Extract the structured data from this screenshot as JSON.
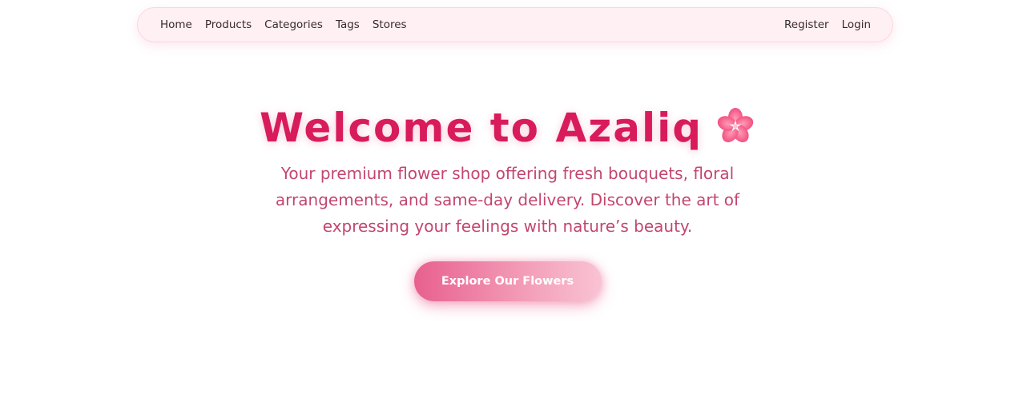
{
  "nav": {
    "left_links": [
      "Home",
      "Products",
      "Categories",
      "Tags",
      "Stores"
    ],
    "right_links": [
      "Register",
      "Login"
    ]
  },
  "hero": {
    "title": "Welcome to Azaliq",
    "icon": "cherry-blossom-icon",
    "subtitle": "Your premium flower shop offering fresh bouquets, floral arrangements, and same-day delivery. Discover the art of expressing your feelings with nature’s beauty.",
    "cta_label": "Explore Our Flowers"
  },
  "colors": {
    "brand": "#d81b5b",
    "subtitle": "#c2466e",
    "nav_background": "#fff0f4",
    "cta_start": "#e8608e",
    "cta_end": "#f9c3d3"
  }
}
